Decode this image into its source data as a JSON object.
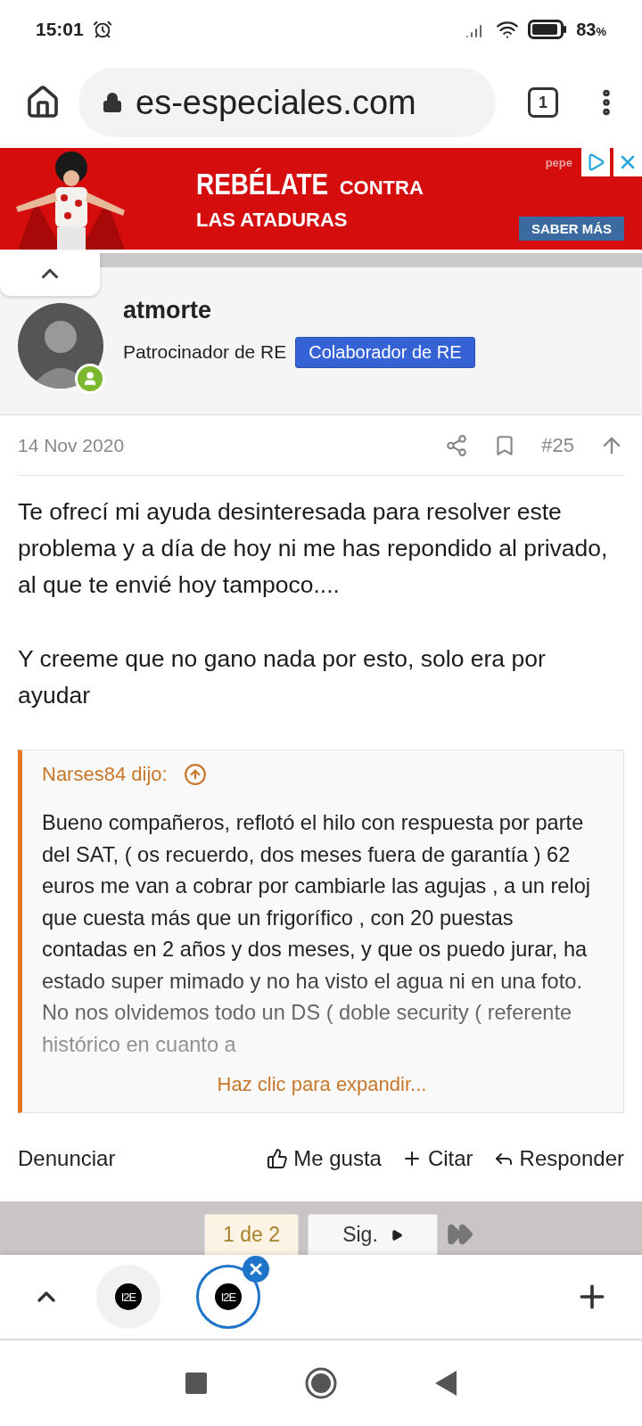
{
  "status_bar": {
    "time": "15:01",
    "battery": "83",
    "battery_unit": "%"
  },
  "browser": {
    "url": "es-especiales.com",
    "tab_count": "1"
  },
  "ad": {
    "headline": "REBÉLATE",
    "headline_suffix": "CONTRA",
    "subline": "LAS ATADURAS",
    "brand": "pepe",
    "cta": "SABER MÁS"
  },
  "post": {
    "author": "atmorte",
    "online": true,
    "title": "Patrocinador de RE",
    "badge": "Colaborador de RE",
    "date": "14 Nov 2020",
    "number": "#25",
    "paragraphs": [
      "Te ofrecí mi ayuda desinteresada para resolver este problema y a día de hoy ni me has repondido al privado, al que te envié hoy tampoco....",
      "Y creeme que no gano nada por esto, solo era por ayudar"
    ],
    "quote": {
      "author": "Narses84 dijo:",
      "text": "Bueno compañeros, reflotó el hilo con respuesta por parte del SAT, ( os recuerdo, dos meses fuera de garantía ) 62 euros me van a cobrar por cambiarle las agujas , a un reloj que cuesta más que un frigorífico , con 20 puestas contadas en 2 años y dos meses, y que os puedo jurar, ha estado super mimado y no ha visto el agua ni en una foto. No nos olvidemos todo un DS ( doble security ( referente histórico en cuanto a",
      "expand": "Haz clic para expandir..."
    },
    "actions": [
      {
        "kind": "report",
        "label": "Denunciar"
      },
      {
        "kind": "like",
        "label": "Me gusta"
      },
      {
        "kind": "quote",
        "label": "Citar"
      },
      {
        "kind": "reply",
        "label": "Responder"
      }
    ]
  },
  "pagination": {
    "pages": [
      {
        "label": "1 de 2",
        "selected": true
      }
    ],
    "next": "Sig."
  },
  "tab_strip": {
    "tabs": [
      {
        "logo": "I2E",
        "selected": false
      },
      {
        "logo": "I2E",
        "selected": true
      }
    ]
  }
}
